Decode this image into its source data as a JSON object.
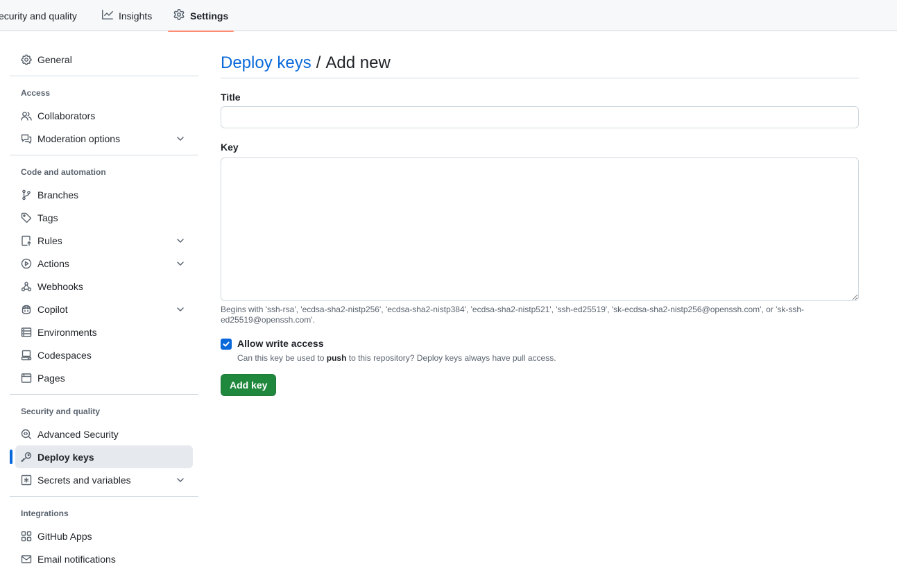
{
  "tabs": [
    {
      "label": "ecurity and quality",
      "icon": "",
      "active": false
    },
    {
      "label": "Insights",
      "icon": "graph-icon",
      "active": false
    },
    {
      "label": "Settings",
      "icon": "gear-icon",
      "active": true
    }
  ],
  "sidebar": {
    "general": {
      "label": "General",
      "icon": "gear-icon"
    },
    "sections": [
      {
        "heading": "Access",
        "items": [
          {
            "label": "Collaborators",
            "icon": "people-icon",
            "expandable": false
          },
          {
            "label": "Moderation options",
            "icon": "comment-icon",
            "expandable": true
          }
        ]
      },
      {
        "heading": "Code and automation",
        "items": [
          {
            "label": "Branches",
            "icon": "branch-icon",
            "expandable": false
          },
          {
            "label": "Tags",
            "icon": "tag-icon",
            "expandable": false
          },
          {
            "label": "Rules",
            "icon": "rules-icon",
            "expandable": true
          },
          {
            "label": "Actions",
            "icon": "play-icon",
            "expandable": true
          },
          {
            "label": "Webhooks",
            "icon": "webhook-icon",
            "expandable": false
          },
          {
            "label": "Copilot",
            "icon": "copilot-icon",
            "expandable": true
          },
          {
            "label": "Environments",
            "icon": "server-icon",
            "expandable": false
          },
          {
            "label": "Codespaces",
            "icon": "codespaces-icon",
            "expandable": false
          },
          {
            "label": "Pages",
            "icon": "browser-icon",
            "expandable": false
          }
        ]
      },
      {
        "heading": "Security and quality",
        "items": [
          {
            "label": "Advanced Security",
            "icon": "codescan-icon",
            "expandable": false
          },
          {
            "label": "Deploy keys",
            "icon": "key-icon",
            "expandable": false,
            "selected": true
          },
          {
            "label": "Secrets and variables",
            "icon": "asterisk-icon",
            "expandable": true
          }
        ]
      },
      {
        "heading": "Integrations",
        "items": [
          {
            "label": "GitHub Apps",
            "icon": "apps-icon",
            "expandable": false
          },
          {
            "label": "Email notifications",
            "icon": "mail-icon",
            "expandable": false
          }
        ]
      }
    ]
  },
  "main": {
    "breadcrumb_link": "Deploy keys",
    "breadcrumb_sep": "/",
    "breadcrumb_current": "Add new",
    "title_label": "Title",
    "title_value": "",
    "key_label": "Key",
    "key_value": "",
    "key_hint": "Begins with 'ssh-rsa', 'ecdsa-sha2-nistp256', 'ecdsa-sha2-nistp384', 'ecdsa-sha2-nistp521', 'ssh-ed25519', 'sk-ecdsa-sha2-nistp256@openssh.com', or 'sk-ssh-ed25519@openssh.com'.",
    "allow_write_label": "Allow write access",
    "allow_write_checked": true,
    "allow_write_desc_prefix": "Can this key be used to ",
    "allow_write_desc_bold": "push",
    "allow_write_desc_suffix": " to this repository? Deploy keys always have pull access.",
    "submit_label": "Add key"
  },
  "colors": {
    "accent": "#0969da",
    "primary_button": "#1f883d",
    "active_tab_underline": "#fd8c73"
  }
}
